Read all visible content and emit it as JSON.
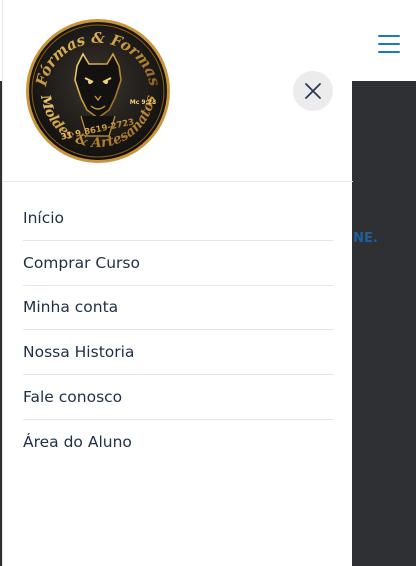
{
  "page": {
    "peek_text": "LINE."
  },
  "header": {
    "menu_icon": "hamburger-menu-icon",
    "accent_color": "#1c76c9"
  },
  "drawer": {
    "logo": {
      "top_text": "Fórmas & Formas",
      "bottom_text": "Moldes & Artesanatos",
      "phone": "31 9.8619-2723",
      "verse": "Mc 9:23",
      "emblem": "panther-icon"
    },
    "close_icon": "close-icon",
    "menu_items": [
      "Início",
      "Comprar Curso",
      "Minha conta",
      "Nossa Historia",
      "Fale conosco",
      "Área do Aluno"
    ]
  }
}
